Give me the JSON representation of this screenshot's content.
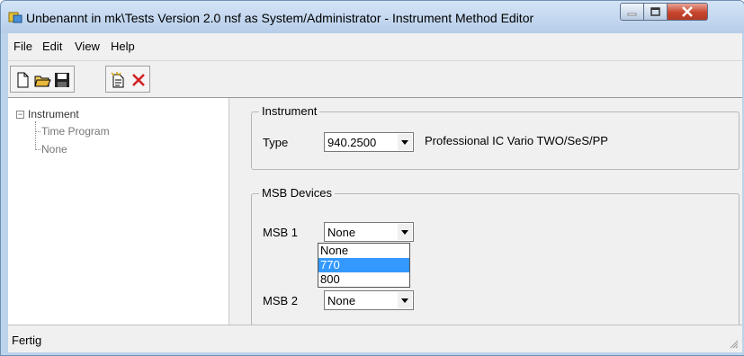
{
  "window": {
    "title": "Unbenannt in mk\\Tests Version 2.0 nsf as System/Administrator - Instrument Method Editor",
    "controls": [
      "minimize-icon",
      "maximize-icon",
      "close-icon"
    ]
  },
  "menu": {
    "items": [
      {
        "label": "File"
      },
      {
        "label": "Edit"
      },
      {
        "label": "View"
      },
      {
        "label": "Help"
      }
    ]
  },
  "toolbar": {
    "buttons": [
      "new-document-icon",
      "open-folder-icon",
      "save-icon",
      "copy-document-icon",
      "delete-icon"
    ]
  },
  "tree": {
    "root": "Instrument",
    "children": [
      "Time Program",
      "None"
    ]
  },
  "instrument_group": {
    "title": "Instrument",
    "type_label": "Type",
    "type_value": "940.2500",
    "type_description": "Professional IC Vario TWO/SeS/PP"
  },
  "msb_group": {
    "title": "MSB Devices",
    "msb1_label": "MSB 1",
    "msb1_value": "None",
    "msb1_options": [
      "None",
      "770",
      "800"
    ],
    "msb1_highlighted": "770",
    "msb2_label": "MSB 2",
    "msb2_value": "None"
  },
  "status": {
    "text": "Fertig"
  }
}
